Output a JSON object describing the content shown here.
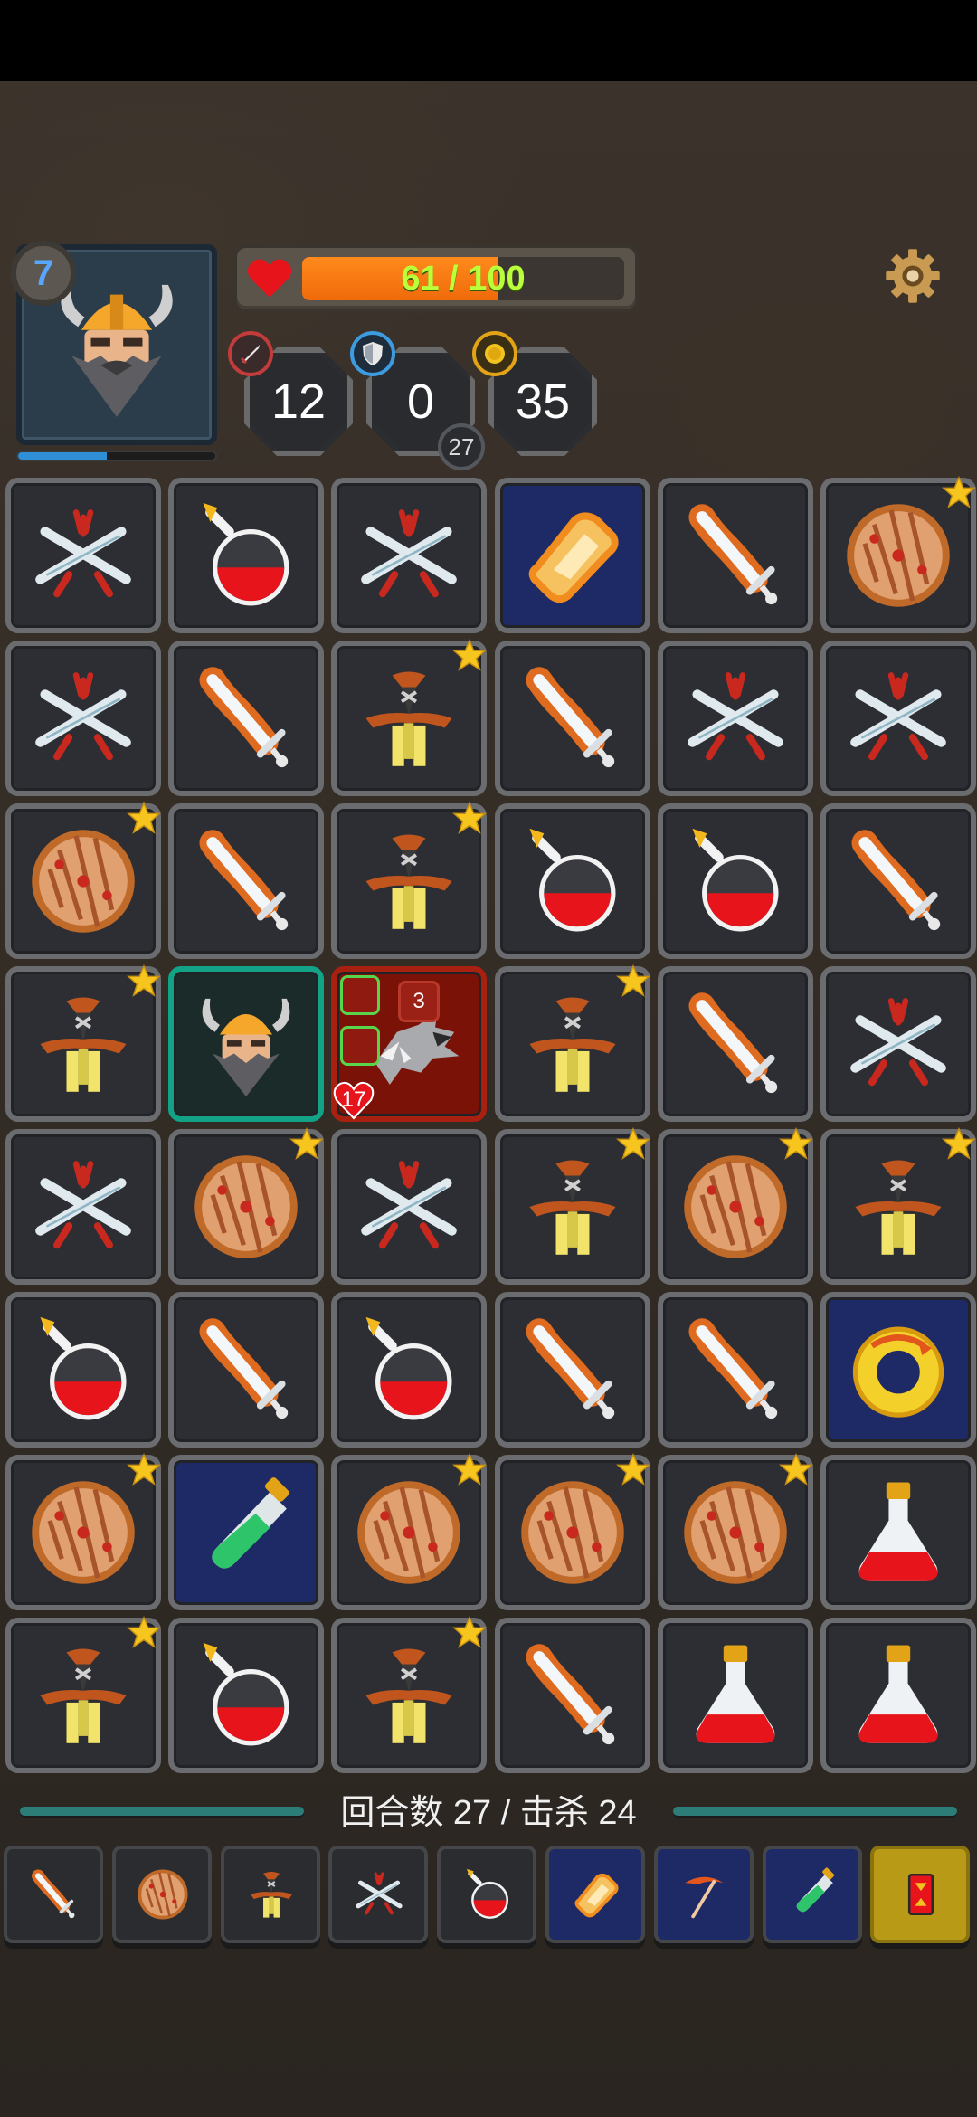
{
  "player": {
    "level": "7",
    "xp_progress": 0.45,
    "hp_current": 61,
    "hp_max": 100,
    "hp_text": "61 / 100"
  },
  "stats": {
    "attack": "12",
    "armor": "0",
    "armor_sub": "27",
    "gold": "35"
  },
  "board": [
    [
      "swords",
      "potion",
      "swords",
      "gold-ingot",
      "flame-sword",
      "shield"
    ],
    [
      "swords",
      "flame-sword",
      "dagger",
      "flame-sword",
      "swords",
      "swords"
    ],
    [
      "shield",
      "flame-sword",
      "dagger",
      "potion",
      "potion",
      "flame-sword"
    ],
    [
      "dagger",
      "hero",
      "wolf",
      "dagger",
      "flame-sword",
      "swords"
    ],
    [
      "swords",
      "shield",
      "swords",
      "dagger",
      "shield",
      "dagger"
    ],
    [
      "potion",
      "flame-sword",
      "potion",
      "flame-sword",
      "flame-sword",
      "gold-ring"
    ],
    [
      "shield",
      "green-vial",
      "shield",
      "shield",
      "shield",
      "flask"
    ],
    [
      "dagger",
      "potion",
      "dagger",
      "flame-sword",
      "flask",
      "flask"
    ]
  ],
  "stars": [
    [
      false,
      false,
      false,
      false,
      false,
      true
    ],
    [
      false,
      false,
      true,
      false,
      false,
      false
    ],
    [
      true,
      false,
      true,
      false,
      false,
      false
    ],
    [
      true,
      false,
      false,
      true,
      false,
      false
    ],
    [
      false,
      true,
      false,
      true,
      true,
      true
    ],
    [
      false,
      false,
      false,
      false,
      false,
      false
    ],
    [
      true,
      false,
      true,
      true,
      true,
      false
    ],
    [
      true,
      false,
      true,
      false,
      false,
      false
    ]
  ],
  "enemy": {
    "count": "3",
    "hp": "17"
  },
  "footer": {
    "turn_text": "回合数 27 / 击杀 24"
  },
  "inventory": [
    "flame-sword",
    "shield",
    "dagger",
    "swords",
    "potion",
    "gold-ingot",
    "scythe",
    "green-vial",
    "red-card"
  ],
  "colors": {
    "hp": "#f07a10",
    "hp_text": "#b9ff3a",
    "hero_border": "#12a386",
    "enemy_bg": "#7a1208",
    "rare_bg": "#1d2a66",
    "xp": "#2f8fd6"
  }
}
